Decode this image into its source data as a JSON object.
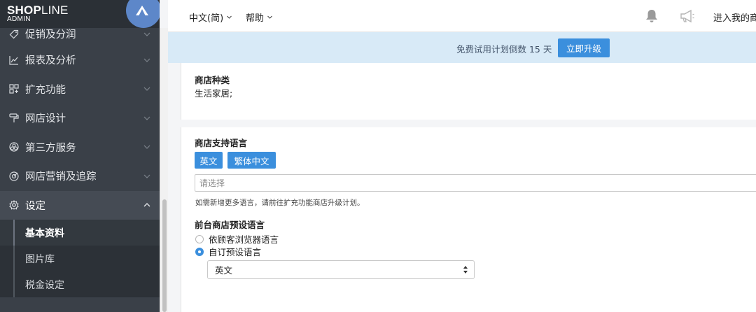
{
  "brand": {
    "name_bold": "SHOP",
    "name_light": "LINE",
    "sub": "ADMIN"
  },
  "colors": {
    "accent": "#3b8fdd",
    "sidebar_bg": "#3a4048",
    "banner_bg": "#d8eaf7"
  },
  "sidebar": {
    "items": [
      {
        "label": "促销及分润",
        "icon": "tag-icon"
      },
      {
        "label": "报表及分析",
        "icon": "chart-icon"
      },
      {
        "label": "扩充功能",
        "icon": "apps-icon"
      },
      {
        "label": "网店设计",
        "icon": "paint-roller-icon"
      },
      {
        "label": "第三方服务",
        "icon": "integrations-icon"
      },
      {
        "label": "网店营销及追踪",
        "icon": "target-icon"
      },
      {
        "label": "设定",
        "icon": "gear-icon"
      }
    ],
    "sub_items": [
      {
        "label": "基本资料",
        "active": true
      },
      {
        "label": "图片库",
        "active": false
      },
      {
        "label": "税金设定",
        "active": false
      }
    ]
  },
  "topbar": {
    "language_menu": "中文(简)",
    "help_menu": "帮助",
    "store_link": "进入我的商"
  },
  "banner": {
    "text": "免费试用计划倒数 15 天",
    "upgrade_button": "立即升级"
  },
  "store_category": {
    "label": "商店种类",
    "value": "生活家居;"
  },
  "store_languages": {
    "label": "商店支持语言",
    "tags": [
      "英文",
      "繁体中文"
    ],
    "placeholder": "请选择",
    "hint": "如需新增更多语言，请前往扩充功能商店升级计划。"
  },
  "default_language": {
    "label": "前台商店预设语言",
    "options": [
      {
        "label": "依顾客浏览器语言",
        "selected": false
      },
      {
        "label": "自订预设语言",
        "selected": true
      }
    ],
    "dropdown_value": "英文"
  }
}
